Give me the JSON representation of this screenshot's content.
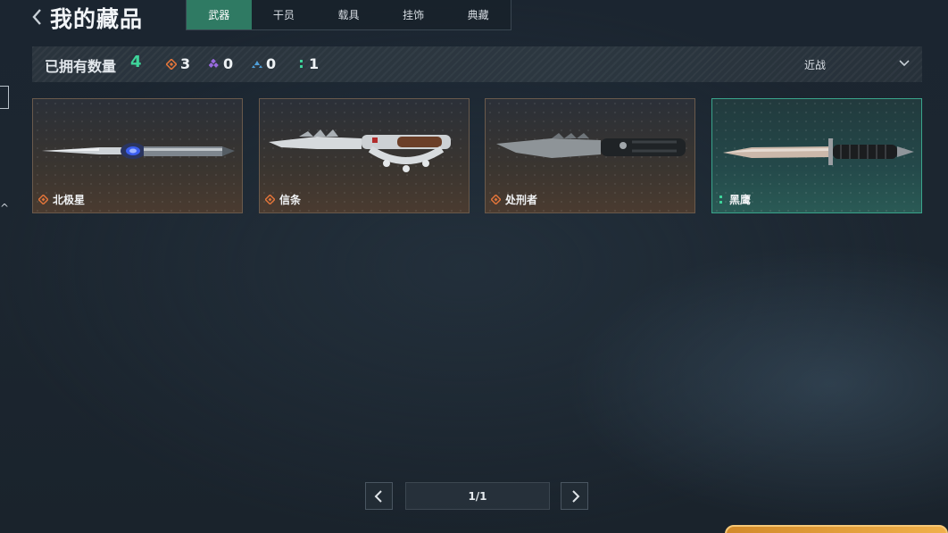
{
  "header": {
    "title": "我的藏品",
    "tabs": [
      {
        "label": "武器",
        "active": true
      },
      {
        "label": "干员",
        "active": false
      },
      {
        "label": "载具",
        "active": false
      },
      {
        "label": "挂饰",
        "active": false
      },
      {
        "label": "典藏",
        "active": false
      }
    ]
  },
  "stats": {
    "owned_label": "已拥有数量",
    "owned_count": "4",
    "rarities": [
      {
        "icon": "orange-diamond-icon",
        "color": "#e0743a",
        "count": "3"
      },
      {
        "icon": "purple-diamond-icon",
        "color": "#9a6ae0",
        "count": "0"
      },
      {
        "icon": "blue-triangle-icon",
        "color": "#4f9ed8",
        "count": "0"
      },
      {
        "icon": "green-dots-icon",
        "color": "#3ed49a",
        "count": "1"
      }
    ],
    "sort_label": "近战"
  },
  "items": [
    {
      "name": "北极星",
      "rarity_icon": "orange-diamond-icon",
      "rarity_color": "#e0743a",
      "style": "brown"
    },
    {
      "name": "信条",
      "rarity_icon": "orange-diamond-icon",
      "rarity_color": "#e0743a",
      "style": "brown"
    },
    {
      "name": "处刑者",
      "rarity_icon": "orange-diamond-icon",
      "rarity_color": "#e0743a",
      "style": "brown"
    },
    {
      "name": "黑鹰",
      "rarity_icon": "green-dots-icon",
      "rarity_color": "#3ed49a",
      "style": "teal"
    }
  ],
  "pagination": {
    "indicator": "1/1"
  },
  "colors": {
    "accent": "#2f7a63",
    "count_green": "#3ed49a",
    "card_border": "#6a5a4c",
    "card_border_teal": "#3aa58c"
  }
}
